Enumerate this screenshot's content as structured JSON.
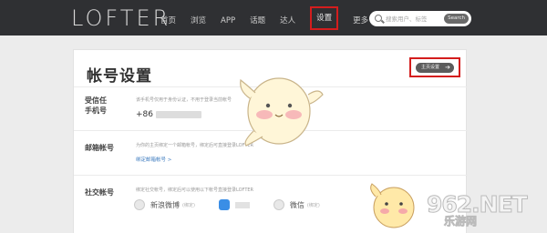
{
  "header": {
    "logo": "LOFTER",
    "nav": [
      {
        "label": "首页"
      },
      {
        "label": "浏览"
      },
      {
        "label": "APP"
      },
      {
        "label": "话题"
      },
      {
        "label": "达人"
      },
      {
        "label": "设置"
      },
      {
        "label": "更多"
      }
    ],
    "search": {
      "placeholder": "搜索用户、标签",
      "button": "Search"
    }
  },
  "panel": {
    "title": "帐号设置",
    "home_button": "主页设置",
    "rows": {
      "phone": {
        "label_line1": "受信任",
        "label_line2": "手机号",
        "desc": "该手机号仅用于身份认证，不用于登录当前帐号",
        "value": "+86"
      },
      "email": {
        "label": "邮箱帐号",
        "desc": "为你的主页绑定一个邮箱帐号，绑定后可直接登录LOFTER",
        "link": "绑定邮箱帐号 >"
      },
      "social": {
        "label": "社交帐号",
        "desc": "绑定社交帐号，绑定后可以使用以下帐号直接登录LOFTER",
        "accounts": [
          {
            "name": "新浪微博",
            "tag": "(绑定)",
            "icon": "weibo-icon",
            "color": "#e8e8e8"
          },
          {
            "name": "",
            "tag": "",
            "icon": "qq-icon",
            "color": "#3a8ee6"
          },
          {
            "name": "微信",
            "tag": "(绑定)",
            "icon": "wechat-icon",
            "color": "#e8e8e8"
          }
        ]
      }
    }
  },
  "watermark": {
    "big": "962.NET",
    "small": "乐游网"
  },
  "colors": {
    "highlight": "#d41d1d",
    "topbar": "#2f3033",
    "link": "#3d7bbf"
  }
}
